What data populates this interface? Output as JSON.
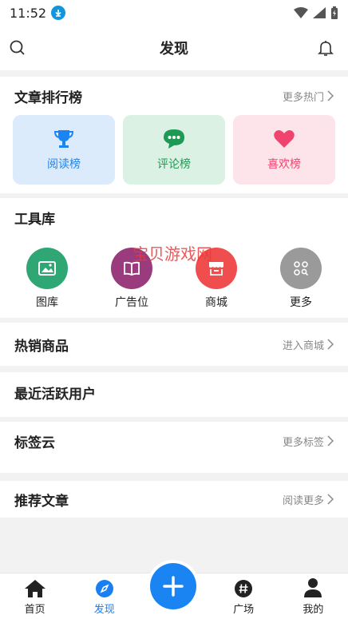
{
  "status": {
    "time": "11:52"
  },
  "header": {
    "title": "发现"
  },
  "ranking": {
    "title": "文章排行榜",
    "more": "更多热门",
    "tiles": [
      {
        "label": "阅读榜",
        "icon": "trophy-icon",
        "color": "#1a84f3",
        "bg": "#dcebfc"
      },
      {
        "label": "评论榜",
        "icon": "chat-icon",
        "color": "#1e9a55",
        "bg": "#dbf1e4"
      },
      {
        "label": "喜欢榜",
        "icon": "heart-icon",
        "color": "#f0446f",
        "bg": "#fde4ea"
      }
    ]
  },
  "tools": {
    "title": "工具库",
    "items": [
      {
        "label": "图库",
        "icon": "image-icon",
        "color": "#2ea775"
      },
      {
        "label": "广告位",
        "icon": "book-icon",
        "color": "#9a3b7d"
      },
      {
        "label": "商城",
        "icon": "store-icon",
        "color": "#f04e4e"
      },
      {
        "label": "更多",
        "icon": "grid-search-icon",
        "color": "#9a9a9a"
      }
    ]
  },
  "watermark": "宝贝游戏网",
  "hot_goods": {
    "title": "热销商品",
    "more": "进入商城"
  },
  "active_users": {
    "title": "最近活跃用户"
  },
  "tags": {
    "title": "标签云",
    "more": "更多标签"
  },
  "recommend": {
    "title": "推荐文章",
    "more": "阅读更多"
  },
  "nav": {
    "items": [
      {
        "label": "首页",
        "icon": "home-icon"
      },
      {
        "label": "发现",
        "icon": "compass-icon"
      },
      {
        "label": "广场",
        "icon": "hashtag-icon"
      },
      {
        "label": "我的",
        "icon": "user-icon"
      }
    ],
    "fab_icon": "plus-icon"
  },
  "colors": {
    "accent": "#1a84f3"
  }
}
